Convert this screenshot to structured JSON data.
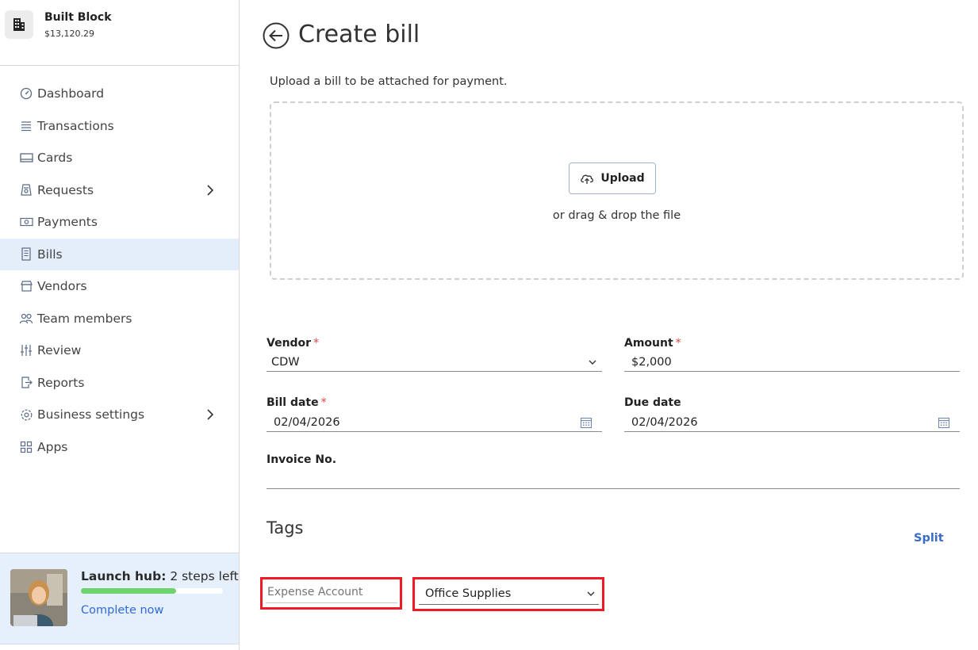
{
  "company": {
    "name": "Built Block",
    "balance": "$13,120.29"
  },
  "sidebar": {
    "items": [
      {
        "label": "Dashboard",
        "icon": "dashboard-icon"
      },
      {
        "label": "Transactions",
        "icon": "list-icon"
      },
      {
        "label": "Cards",
        "icon": "card-icon"
      },
      {
        "label": "Requests",
        "icon": "requests-icon",
        "has_chevron": true
      },
      {
        "label": "Payments",
        "icon": "payments-icon"
      },
      {
        "label": "Bills",
        "icon": "bill-icon",
        "active": true
      },
      {
        "label": "Vendors",
        "icon": "store-icon"
      },
      {
        "label": "Team members",
        "icon": "team-icon"
      },
      {
        "label": "Review",
        "icon": "sliders-icon"
      },
      {
        "label": "Reports",
        "icon": "report-icon"
      },
      {
        "label": "Business settings",
        "icon": "gear-icon",
        "has_chevron": true
      },
      {
        "label": "Apps",
        "icon": "apps-icon"
      }
    ]
  },
  "launch_hub": {
    "title_bold": "Launch hub:",
    "title_rest": " 2 steps left",
    "progress_percent": 67,
    "link": "Complete now"
  },
  "page": {
    "title": "Create bill",
    "upload_hint": "Upload a bill to be attached for payment.",
    "upload_button": "Upload",
    "drag_text": "or drag & drop the file"
  },
  "form": {
    "vendor": {
      "label": "Vendor",
      "required": "*",
      "value": "CDW"
    },
    "amount": {
      "label": "Amount",
      "required": "*",
      "value": "$2,000"
    },
    "bill_date": {
      "label": "Bill date",
      "required": "*",
      "value": "02/04/2026"
    },
    "due_date": {
      "label": "Due date",
      "value": "02/04/2026"
    },
    "invoice_no": {
      "label": "Invoice No.",
      "value": ""
    }
  },
  "tags": {
    "title": "Tags",
    "split": "Split",
    "expense_account_placeholder": "Expense Account",
    "expense_category_value": "Office Supplies"
  },
  "colors": {
    "accent": "#2f6ad6",
    "active_nav_bg": "#e4eefb",
    "highlight_box": "#ee1b24",
    "progress": "#6fd46f"
  }
}
